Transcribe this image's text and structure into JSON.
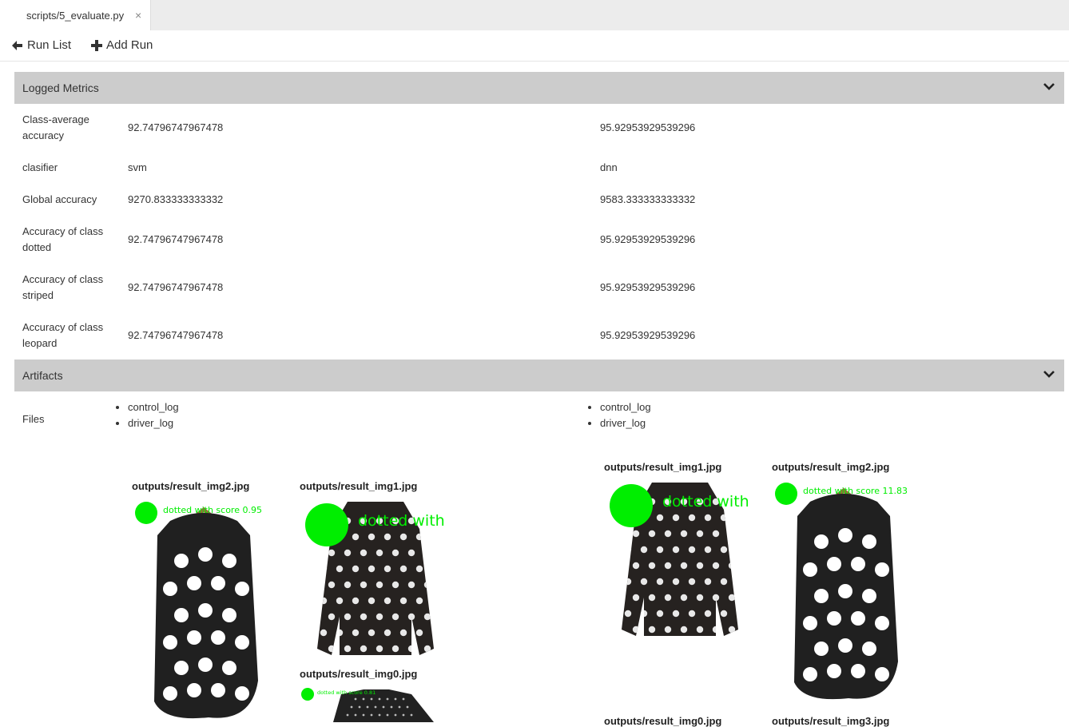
{
  "tab": {
    "title": "scripts/5_evaluate.py",
    "close_glyph": "×"
  },
  "toolbar": {
    "run_list_label": "Run List",
    "add_run_label": "Add Run"
  },
  "metrics_section": {
    "title": "Logged Metrics"
  },
  "metrics": [
    {
      "name": "Class-average accuracy",
      "run1": "92.74796747967478",
      "run2": "95.92953929539296"
    },
    {
      "name": "clasifier",
      "run1": "svm",
      "run2": "dnn"
    },
    {
      "name": "Global accuracy",
      "run1": "9270.833333333332",
      "run2": "9583.333333333332"
    },
    {
      "name": "Accuracy of class dotted",
      "run1": "92.74796747967478",
      "run2": "95.92953929539296"
    },
    {
      "name": "Accuracy of class striped",
      "run1": "92.74796747967478",
      "run2": "95.92953929539296"
    },
    {
      "name": "Accuracy of class leopard",
      "run1": "92.74796747967478",
      "run2": "95.92953929539296"
    }
  ],
  "artifacts_section": {
    "title": "Artifacts"
  },
  "files_label": "Files",
  "files_run1": [
    "control_log",
    "driver_log"
  ],
  "files_run2": [
    "control_log",
    "driver_log"
  ],
  "images_run1": [
    {
      "title": "outputs/result_img2.jpg",
      "overlay": "dotted with score 0.95"
    },
    {
      "title": "outputs/result_img1.jpg",
      "overlay": "dotted with"
    },
    {
      "title": "outputs/result_img0.jpg",
      "overlay": "dotted with score 0.81"
    }
  ],
  "images_run2": [
    {
      "title": "outputs/result_img1.jpg",
      "overlay": "dotted with"
    },
    {
      "title": "outputs/result_img2.jpg",
      "overlay": "dotted with score 11.83"
    },
    {
      "title": "outputs/result_img0.jpg"
    },
    {
      "title": "outputs/result_img3.jpg"
    }
  ],
  "colors": {
    "section_bg": "#cccccc",
    "overlay_green": "#00ee00",
    "tabbar_bg": "#ececec"
  }
}
